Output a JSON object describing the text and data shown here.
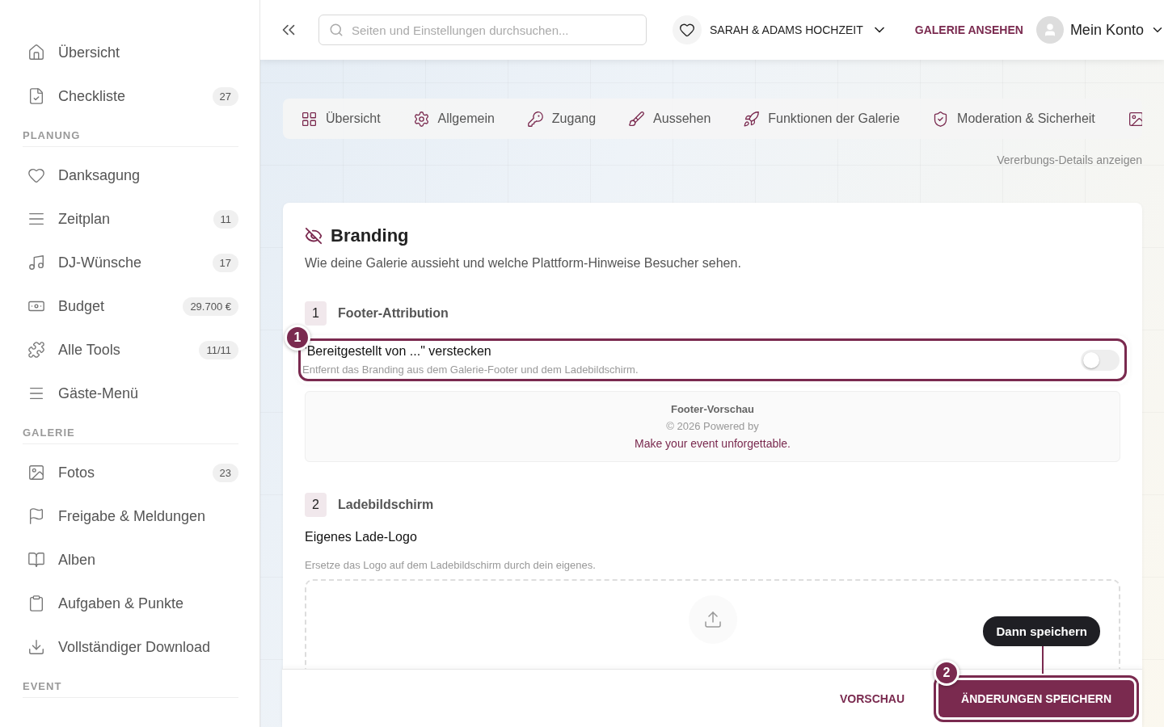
{
  "sidebar": {
    "sections": [
      {
        "items": [
          {
            "label": "Übersicht"
          },
          {
            "label": "Checkliste",
            "count": "27"
          }
        ]
      },
      {
        "title": "PLANUNG",
        "items": [
          {
            "label": "Danksagung"
          },
          {
            "label": "Zeitplan",
            "count": "11"
          },
          {
            "label": "DJ-Wünsche",
            "count": "17"
          },
          {
            "label": "Budget",
            "count": "29.700 €"
          },
          {
            "label": "Alle Tools",
            "count": "11/11"
          },
          {
            "label": "Gäste-Menü"
          }
        ]
      },
      {
        "title": "GALERIE",
        "items": [
          {
            "label": "Fotos",
            "count": "23"
          },
          {
            "label": "Freigabe & Meldungen"
          },
          {
            "label": "Alben"
          },
          {
            "label": "Aufgaben & Punkte"
          },
          {
            "label": "Vollständiger Download"
          }
        ]
      },
      {
        "title": "EVENT"
      }
    ]
  },
  "header": {
    "search_placeholder": "Seiten und Einstellungen durchsuchen...",
    "event": "SARAH & ADAMS HOCHZEIT",
    "gallery_link": "GALERIE ANSEHEN",
    "account": "Mein Konto"
  },
  "tabs": [
    {
      "label": "Übersicht",
      "selected": false
    },
    {
      "label": "Allgemein",
      "selected": false
    },
    {
      "label": "Zugang",
      "selected": false
    },
    {
      "label": "Aussehen",
      "selected": false
    },
    {
      "label": "Funktionen der Galerie",
      "selected": false
    },
    {
      "label": "Moderation & Sicherheit",
      "selected": false
    }
  ],
  "inheritance_link": "Vererbungs-Details anzeigen",
  "card": {
    "title": "Branding",
    "description": "Wie deine Galerie aussieht und welche Plattform-Hinweise Besucher sehen.",
    "sections": [
      {
        "number": "1",
        "title": "Footer-Attribution"
      },
      {
        "number": "2",
        "title": "Ladebildschirm"
      }
    ],
    "toggle": {
      "label": "\"Bereitgestellt von ...\" verstecken",
      "hint": "Entfernt das Branding aus dem Galerie-Footer und dem Ladebildschirm.",
      "on": false
    },
    "preview": {
      "title": "Footer-Vorschau",
      "line": "© 2026 Powered by",
      "tagline": "Make your event unforgettable."
    },
    "logo": {
      "title": "Eigenes Lade-Logo",
      "hint": "Ersetze das Logo auf dem Ladebildschirm durch dein eigenes."
    }
  },
  "footer": {
    "preview_button": "VORSCHAU",
    "save_button": "ÄNDERUNGEN SPEICHERN"
  },
  "annotations": [
    {
      "number": "1"
    },
    {
      "number": "2",
      "tooltip": "Dann speichern"
    }
  ]
}
